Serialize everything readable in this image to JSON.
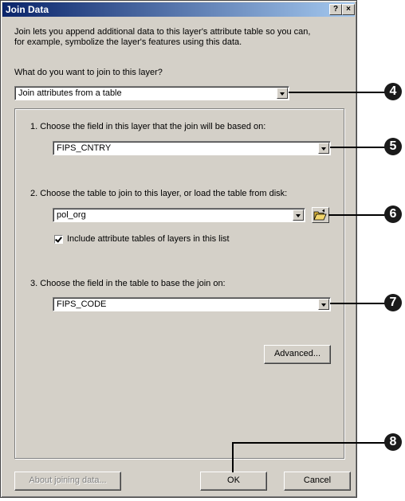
{
  "window": {
    "title": "Join Data",
    "help_button": "?",
    "close_button": "×"
  },
  "intro_text_line1": "Join lets you append additional data to this layer's attribute table so you can,",
  "intro_text_line2": "for example, symbolize the layer's features using this data.",
  "join_type": {
    "label": "What do you want to join to this layer?",
    "value": "Join attributes from a table"
  },
  "step1": {
    "label": "1.  Choose the field in this layer that the join will be based on:",
    "value": "FIPS_CNTRY"
  },
  "step2": {
    "label": "2.  Choose the table to join to this layer, or load the table from disk:",
    "value": "pol_org",
    "checkbox_label": "Include attribute tables of layers in this list",
    "checkbox_checked": true
  },
  "step3": {
    "label": "3.  Choose the field in the table to base the join on:",
    "value": "FIPS_CODE"
  },
  "buttons": {
    "advanced": "Advanced...",
    "about": "About joining data...",
    "ok": "OK",
    "cancel": "Cancel"
  },
  "callouts": [
    "4",
    "5",
    "6",
    "7",
    "8"
  ]
}
